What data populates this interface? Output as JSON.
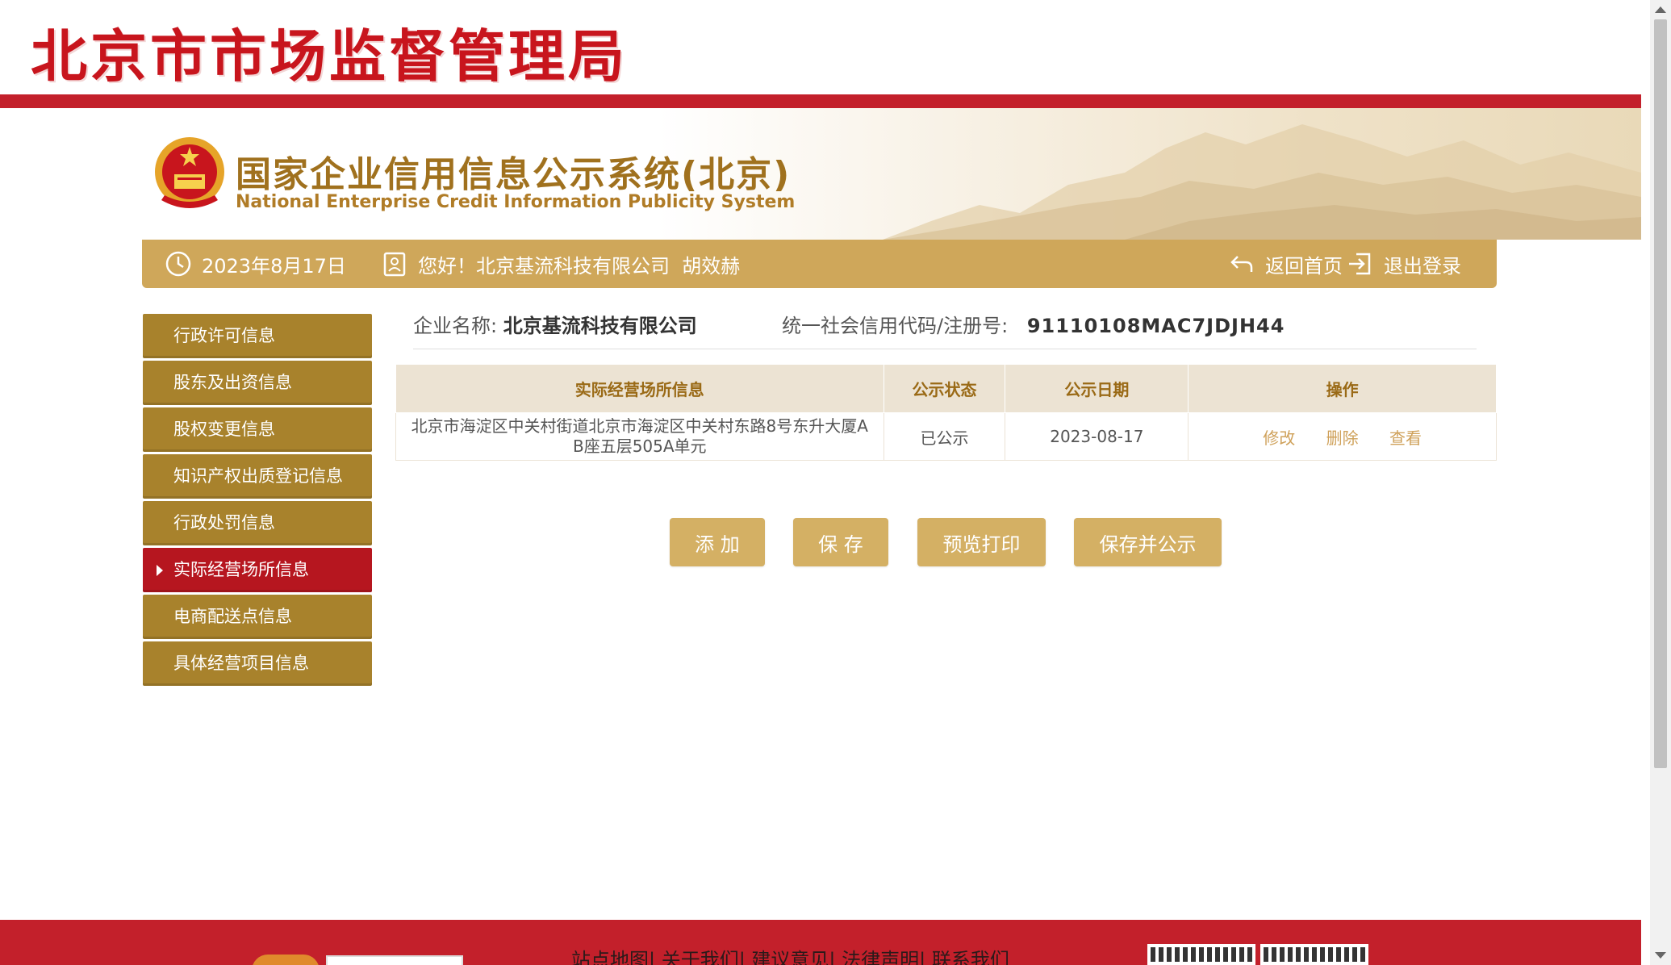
{
  "header": {
    "brand_title": "北京市市场监督管理局",
    "system_title": "国家企业信用信息公示系统(北京)",
    "system_subtitle": "National Enterprise Credit Information Publicity System"
  },
  "infobar": {
    "date": "2023年8月17日",
    "greeting": "您好！北京基流科技有限公司  胡效赫",
    "home_link": "返回首页",
    "logout_link": "退出登录"
  },
  "sidebar": {
    "items": [
      {
        "label": "行政许可信息",
        "active": false
      },
      {
        "label": "股东及出资信息",
        "active": false
      },
      {
        "label": "股权变更信息",
        "active": false
      },
      {
        "label": "知识产权出质登记信息",
        "active": false
      },
      {
        "label": "行政处罚信息",
        "active": false
      },
      {
        "label": "实际经营场所信息",
        "active": true
      },
      {
        "label": "电商配送点信息",
        "active": false
      },
      {
        "label": "具体经营项目信息",
        "active": false
      }
    ]
  },
  "company": {
    "name_label": "企业名称:",
    "name": "北京基流科技有限公司",
    "code_label": "统一社会信用代码/注册号:",
    "code": "91110108MAC7JDJH44"
  },
  "table": {
    "headers": [
      "实际经营场所信息",
      "公示状态",
      "公示日期",
      "操作"
    ],
    "rows": [
      {
        "address_line1": "北京市海淀区中关村街道北京市海淀区中关村东路8号东升大厦A",
        "address_line2": "B座五层505A单元",
        "status": "已公示",
        "date": "2023-08-17",
        "actions": [
          "修改",
          "删除",
          "查看"
        ]
      }
    ]
  },
  "buttons": {
    "add": "添 加",
    "save": "保 存",
    "preview_print": "预览打印",
    "save_publish": "保存并公示"
  },
  "footer": {
    "links": "站点地图| 关于我们| 建议意见| 法律声明| 联系我们"
  },
  "colors": {
    "brand_red": "#c3202b",
    "gold": "#cfa75a",
    "sidebar_gold": "#a8822c",
    "active_red": "#b6161f"
  }
}
